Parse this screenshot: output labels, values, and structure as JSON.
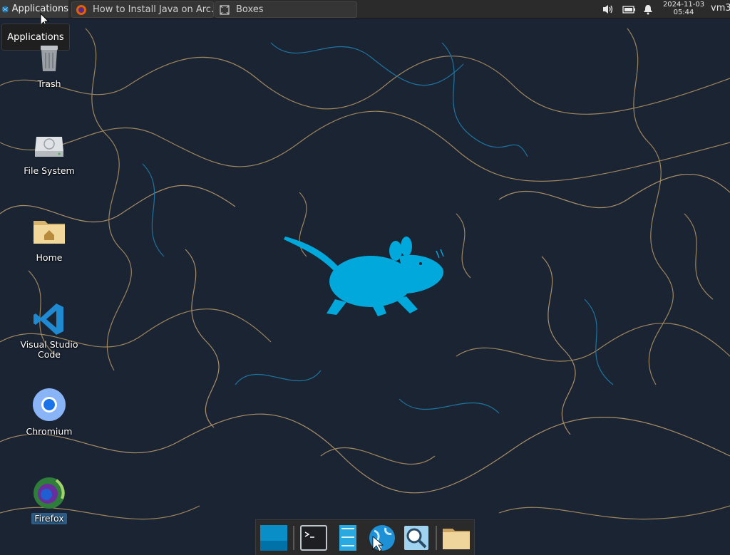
{
  "panel": {
    "applications_label": "Applications",
    "tasks": [
      {
        "title": "How to Install Java on Arc...",
        "icon": "firefox-icon"
      },
      {
        "title": "Boxes",
        "icon": "boxes-icon"
      }
    ],
    "clock_date": "2024-11-03",
    "clock_time": "05:44",
    "hostname": "vm3"
  },
  "tooltip": "Applications",
  "desktop": {
    "icons": [
      {
        "label": "Trash",
        "icon": "trash-icon"
      },
      {
        "label": "File System",
        "icon": "drive-icon"
      },
      {
        "label": "Home",
        "icon": "home-folder-icon"
      },
      {
        "label": "Visual Studio Code",
        "icon": "vscode-icon"
      },
      {
        "label": "Chromium",
        "icon": "chromium-icon"
      },
      {
        "label": "Firefox",
        "icon": "firefox-icon"
      }
    ]
  },
  "dock": {
    "items": [
      "show-desktop",
      "terminal",
      "file-manager-column",
      "web-browser",
      "app-finder",
      "folder"
    ]
  },
  "colors": {
    "accent": "#00a8dc",
    "wallpaper_bg": "#1b2433"
  }
}
